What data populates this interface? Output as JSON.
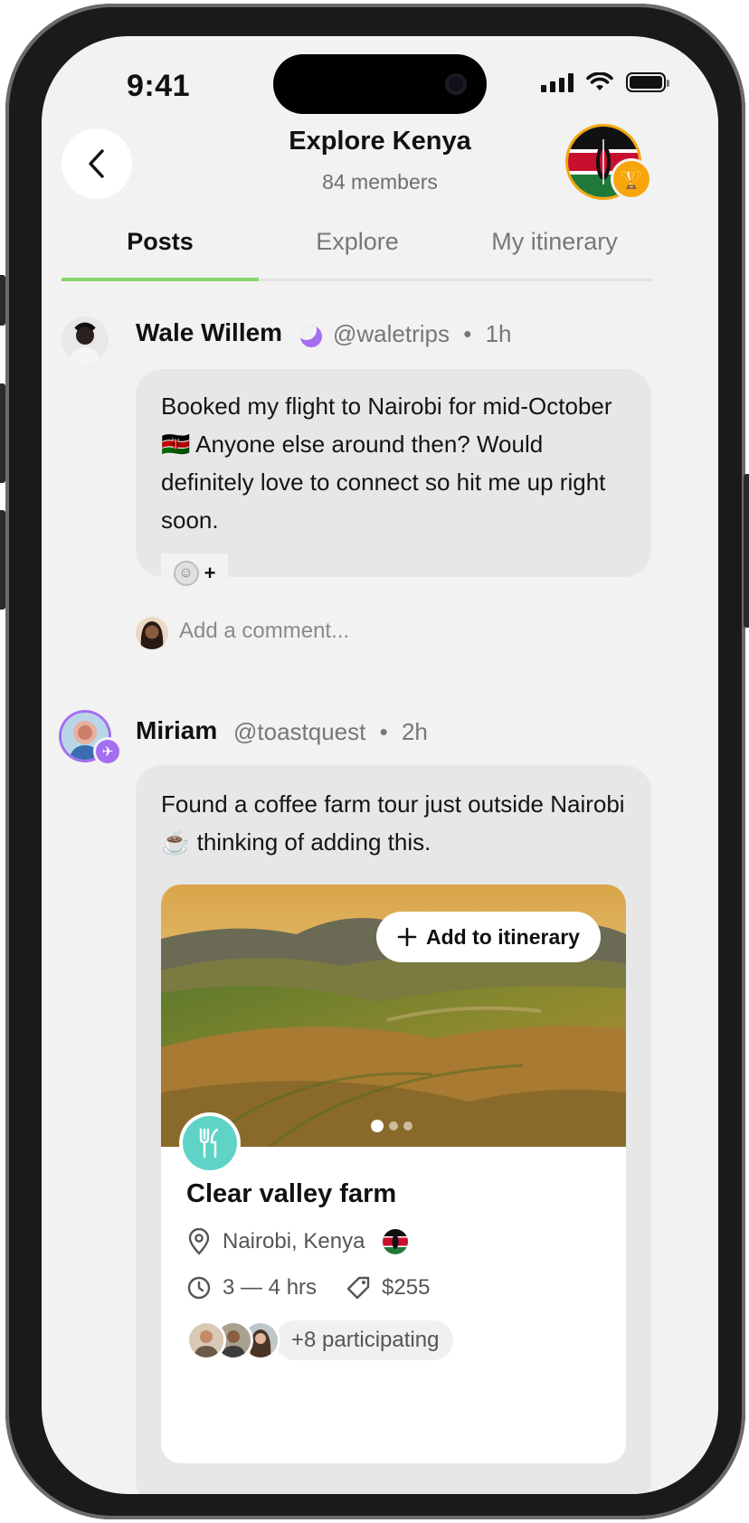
{
  "status_bar": {
    "time": "9:41"
  },
  "header": {
    "title": "Explore Kenya",
    "members": "84 members"
  },
  "tabs": [
    {
      "label": "Posts",
      "active": true
    },
    {
      "label": "Explore",
      "active": false
    },
    {
      "label": "My itinerary",
      "active": false
    }
  ],
  "posts": [
    {
      "author": "Wale Willem",
      "handle": "@waletrips",
      "time": "1h",
      "text": "Booked my flight to Nairobi for mid-October 🇰🇪 Anyone else around then? Would definitely love to connect so hit me up right soon.",
      "reaction_plus": "+",
      "comment_placeholder": "Add a comment..."
    },
    {
      "author": "Miriam",
      "handle": "@toastquest",
      "time": "2h",
      "text": "Found a coffee farm tour just outside Nairobi ☕ thinking of adding this.",
      "card": {
        "add_button": "Add to itinerary",
        "title": "Clear valley farm",
        "location": "Nairobi, Kenya",
        "duration": "3 — 4 hrs",
        "price": "$255",
        "participating": "+8 participating",
        "image_pages": 3,
        "active_page": 1
      }
    }
  ],
  "colors": {
    "accent_green": "#86d46a",
    "trophy_gold": "#f6a60c",
    "category_teal": "#5fd3c5",
    "verified_purple": "#a46ef0"
  }
}
